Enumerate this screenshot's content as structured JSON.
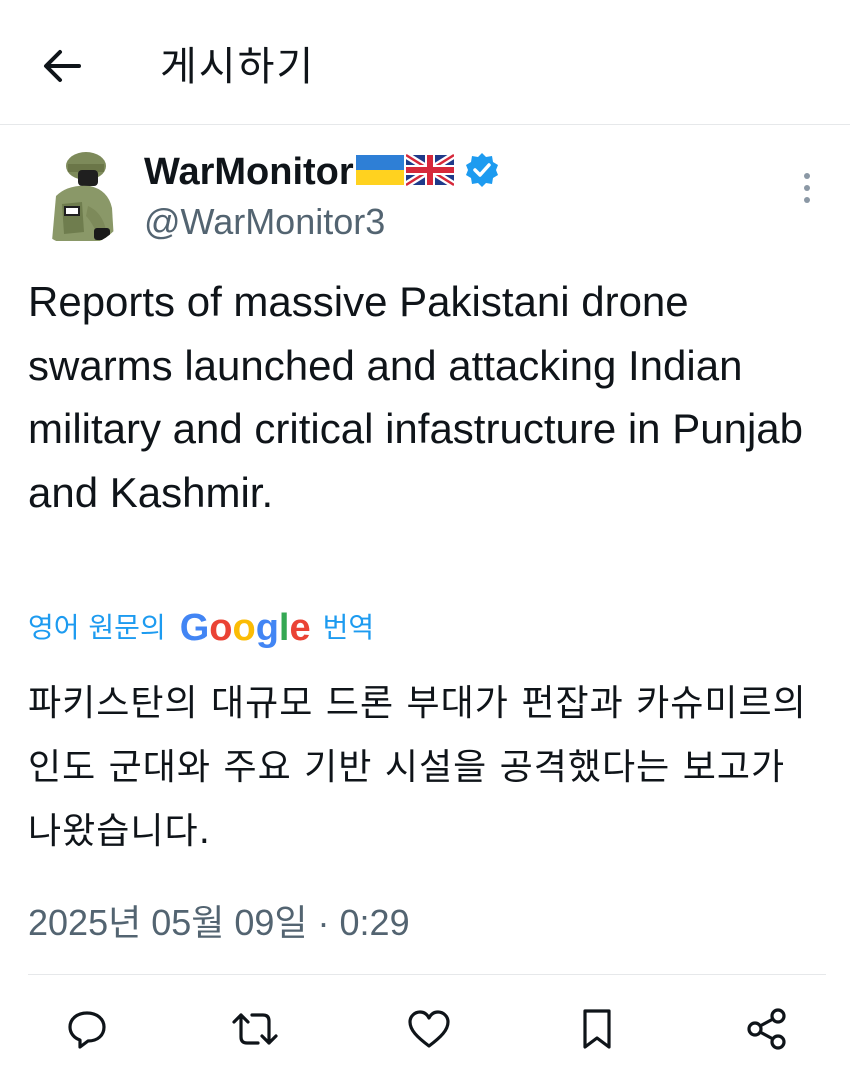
{
  "header": {
    "title": "게시하기",
    "back_icon": "arrow-left-icon"
  },
  "post": {
    "author": {
      "display_name": "WarMonitor",
      "flags": [
        "ukraine-flag",
        "uk-flag"
      ],
      "verified_icon": "verified-badge-icon",
      "handle": "@WarMonitor3"
    },
    "text": "Reports of massive Pakistani drone swarms launched and attacking Indian military and critical infastructure in Punjab and Kashmir.",
    "translation": {
      "prefix": "영어 원문의",
      "brand": "Google",
      "suffix": "번역",
      "text": "파키스탄의 대규모 드론 부대가 펀잡과 카슈미르의 인도 군대와 주요 기반 시설을 공격했다는 보고가 나왔습니다."
    },
    "timestamp": "2025년 05월 09일 · 0:29"
  },
  "actions": [
    {
      "name": "reply",
      "icon": "reply-icon"
    },
    {
      "name": "repost",
      "icon": "repost-icon"
    },
    {
      "name": "like",
      "icon": "heart-icon"
    },
    {
      "name": "bookmark",
      "icon": "bookmark-icon"
    },
    {
      "name": "share",
      "icon": "share-icon"
    }
  ],
  "colors": {
    "accent": "#1d9bf0",
    "text": "#0f1419",
    "secondary_text": "#536471",
    "divider": "#e6e8ea"
  }
}
